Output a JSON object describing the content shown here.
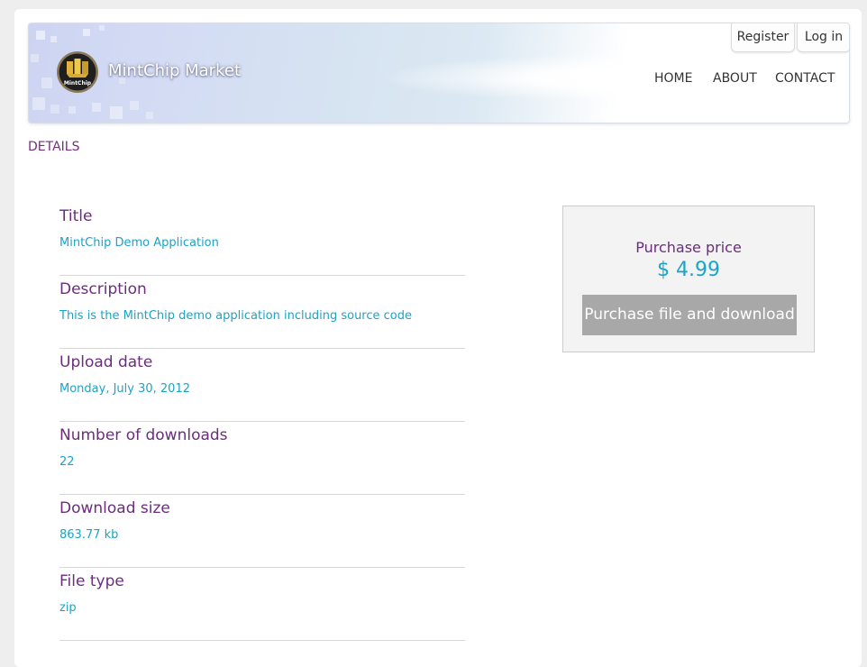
{
  "header": {
    "logo_text": "MintChip",
    "site_title": "MintChip Market",
    "auth": {
      "register_label": "Register",
      "login_label": "Log in"
    },
    "nav": [
      {
        "label": "HOME"
      },
      {
        "label": "ABOUT"
      },
      {
        "label": "CONTACT"
      }
    ]
  },
  "breadcrumb": "DETAILS",
  "details": [
    {
      "label": "Title",
      "value": "MintChip Demo Application"
    },
    {
      "label": "Description",
      "value": "This is the MintChip demo application including source code"
    },
    {
      "label": "Upload date",
      "value": "Monday, July 30, 2012"
    },
    {
      "label": "Number of downloads",
      "value": "22"
    },
    {
      "label": "Download size",
      "value": "863.77 kb"
    },
    {
      "label": "File type",
      "value": "zip"
    }
  ],
  "purchase": {
    "label": "Purchase price",
    "price": "$ 4.99",
    "button_label": "Purchase file and download"
  },
  "colors": {
    "label_purple": "#6b2d7c",
    "value_cyan": "#1aa4c8",
    "button_gray": "#a8a8a8"
  }
}
